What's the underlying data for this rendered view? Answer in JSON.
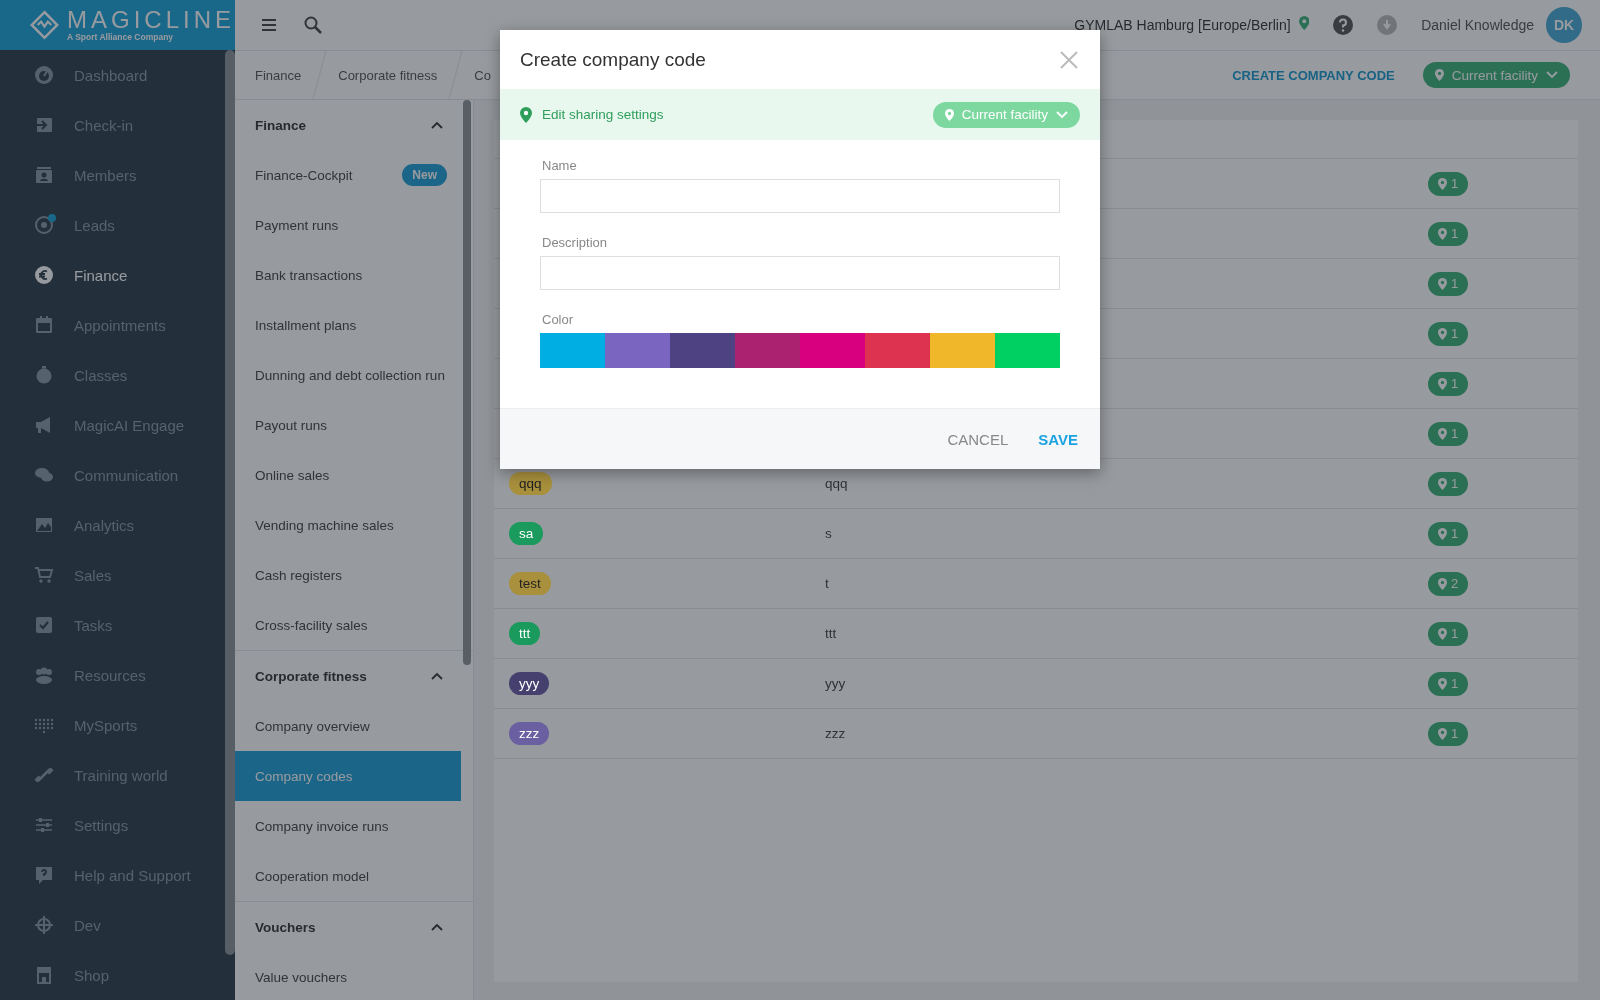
{
  "logo": {
    "name": "MAGICLINE",
    "tagline": "A Sport Alliance Company"
  },
  "sidebar": {
    "items": [
      {
        "label": "Dashboard",
        "selected": false,
        "notification": false
      },
      {
        "label": "Check-in",
        "selected": false,
        "notification": false
      },
      {
        "label": "Members",
        "selected": false,
        "notification": false
      },
      {
        "label": "Leads",
        "selected": false,
        "notification": true
      },
      {
        "label": "Finance",
        "selected": true,
        "notification": false
      },
      {
        "label": "Appointments",
        "selected": false,
        "notification": false
      },
      {
        "label": "Classes",
        "selected": false,
        "notification": false
      },
      {
        "label": "MagicAI Engage",
        "selected": false,
        "notification": false
      },
      {
        "label": "Communication",
        "selected": false,
        "notification": false
      },
      {
        "label": "Analytics",
        "selected": false,
        "notification": false
      },
      {
        "label": "Sales",
        "selected": false,
        "notification": false
      },
      {
        "label": "Tasks",
        "selected": false,
        "notification": false
      },
      {
        "label": "Resources",
        "selected": false,
        "notification": false
      },
      {
        "label": "MySports",
        "selected": false,
        "notification": false
      },
      {
        "label": "Training world",
        "selected": false,
        "notification": false
      },
      {
        "label": "Settings",
        "selected": false,
        "notification": false
      },
      {
        "label": "Help and Support",
        "selected": false,
        "notification": false
      },
      {
        "label": "Dev",
        "selected": false,
        "notification": false
      },
      {
        "label": "Shop",
        "selected": false,
        "notification": false
      }
    ]
  },
  "topbar": {
    "facility": "GYMLAB Hamburg [Europe/Berlin]",
    "user": "Daniel Knowledge",
    "avatar": "DK"
  },
  "breadcrumb": [
    "Finance",
    "Corporate fitness",
    "Co"
  ],
  "toolbar": {
    "create_button": "CREATE COMPANY CODE",
    "facility_filter": "Current facility"
  },
  "submenu": {
    "sections": [
      {
        "title": "Finance",
        "expanded": true,
        "items": [
          {
            "label": "Finance-Cockpit",
            "selected": false,
            "badge": "New"
          },
          {
            "label": "Payment runs",
            "selected": false
          },
          {
            "label": "Bank transactions",
            "selected": false
          },
          {
            "label": "Installment plans",
            "selected": false
          },
          {
            "label": "Dunning and debt collection run",
            "selected": false
          },
          {
            "label": "Payout runs",
            "selected": false
          },
          {
            "label": "Online sales",
            "selected": false
          },
          {
            "label": "Vending machine sales",
            "selected": false
          },
          {
            "label": "Cash registers",
            "selected": false
          },
          {
            "label": "Cross-facility sales",
            "selected": false
          }
        ]
      },
      {
        "title": "Corporate fitness",
        "expanded": true,
        "items": [
          {
            "label": "Company overview",
            "selected": false
          },
          {
            "label": "Company codes",
            "selected": true
          },
          {
            "label": "Company invoice runs",
            "selected": false
          },
          {
            "label": "Cooperation model",
            "selected": false
          }
        ]
      },
      {
        "title": "Vouchers",
        "expanded": true,
        "items": [
          {
            "label": "Value vouchers",
            "selected": false
          }
        ]
      }
    ]
  },
  "table": {
    "rows": [
      {
        "locations": "1"
      },
      {
        "locations": "1"
      },
      {
        "locations": "1"
      },
      {
        "locations": "1"
      },
      {
        "locations": "1"
      },
      {
        "locations": "1"
      },
      {
        "name": "qqq",
        "color": "#a8903c",
        "description": "qqq",
        "locations": "1"
      },
      {
        "name": "sa",
        "color": "#1a9a5c",
        "description": "s",
        "locations": "1"
      },
      {
        "name": "test",
        "color": "#a8903c",
        "description": "t",
        "locations": "2"
      },
      {
        "name": "ttt",
        "color": "#1a9a5c",
        "description": "ttt",
        "locations": "1"
      },
      {
        "name": "yyy",
        "color": "#46406e",
        "description": "yyy",
        "locations": "1"
      },
      {
        "name": "zzz",
        "color": "#6a5fa0",
        "description": "zzz",
        "locations": "1"
      }
    ]
  },
  "dialog": {
    "title": "Create company code",
    "sharing_label": "Edit sharing settings",
    "sharing_scope": "Current facility",
    "fields": [
      {
        "label": "Name"
      },
      {
        "label": "Description"
      }
    ],
    "color_label": "Color",
    "colors": [
      {
        "color": "#00aee3"
      },
      {
        "color": "#7a66c0"
      },
      {
        "color": "#4f4282"
      },
      {
        "color": "#ab2370"
      },
      {
        "color": "#d90080"
      },
      {
        "color": "#de3350"
      },
      {
        "color": "#f0b72a"
      },
      {
        "color": "#00d062"
      }
    ],
    "buttons": [
      {
        "label": "CANCEL",
        "kind": "secondary"
      },
      {
        "label": "SAVE",
        "kind": "primary"
      }
    ]
  }
}
